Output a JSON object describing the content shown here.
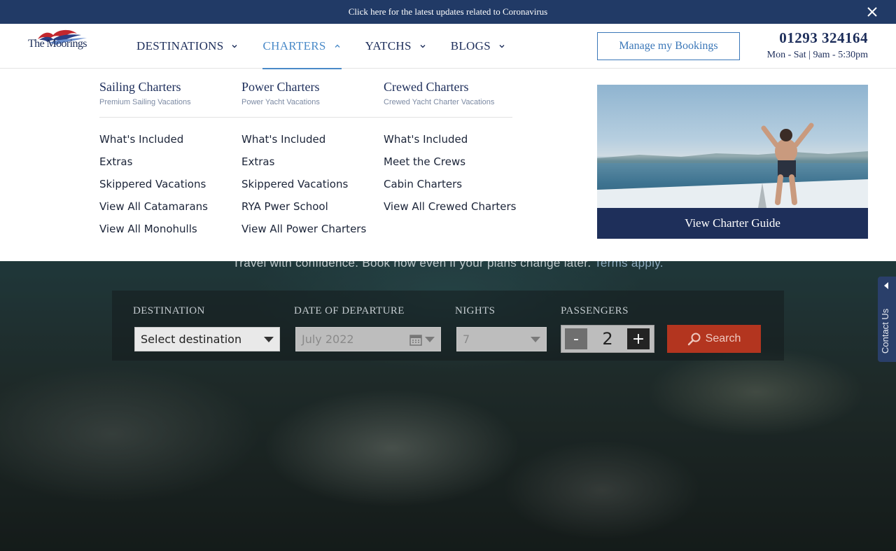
{
  "alert": {
    "text": "Click here for the latest updates related to Coronavirus"
  },
  "brand": {
    "name": "The Moorings"
  },
  "nav": [
    {
      "label": "DESTINATIONS"
    },
    {
      "label": "CHARTERS"
    },
    {
      "label": "YATCHS"
    },
    {
      "label": "BLOGS"
    }
  ],
  "header": {
    "manage_label": "Manage my Bookings",
    "phone": "01293 324164",
    "hours": "Mon - Sat | 9am - 5:30pm"
  },
  "mega": {
    "columns": [
      {
        "title": "Sailing Charters",
        "subtitle": "Premium Sailing Vacations",
        "links": [
          "What's Included",
          "Extras",
          "Skippered Vacations",
          "View All Catamarans",
          "View All Monohulls"
        ]
      },
      {
        "title": "Power Charters",
        "subtitle": "Power Yacht Vacations",
        "links": [
          "What's Included",
          "Extras",
          "Skippered Vacations",
          "RYA Pwer School",
          "View All Power Charters"
        ]
      },
      {
        "title": "Crewed Charters",
        "subtitle": "Crewed Yacht Charter Vacations",
        "links": [
          "What's Included",
          "Meet the Crews",
          "Cabin Charters",
          "View All Crewed Charters"
        ]
      }
    ],
    "promo_label": "View Charter Guide"
  },
  "hero": {
    "tagline": "Travel with confidence. Book now even if your plans change later.",
    "tagline_link": "Terms apply."
  },
  "search": {
    "destination_label": "DESTINATION",
    "destination_value": "Select destination",
    "date_label": "DATE OF DEPARTURE",
    "date_value": "July 2022",
    "nights_label": "NIGHTS",
    "nights_value": "7",
    "passengers_label": "PASSENGERS",
    "passengers_value": "2",
    "minus": "-",
    "plus": "+",
    "button_label": "Search"
  },
  "contact_tab": {
    "label": "Contact Us"
  }
}
